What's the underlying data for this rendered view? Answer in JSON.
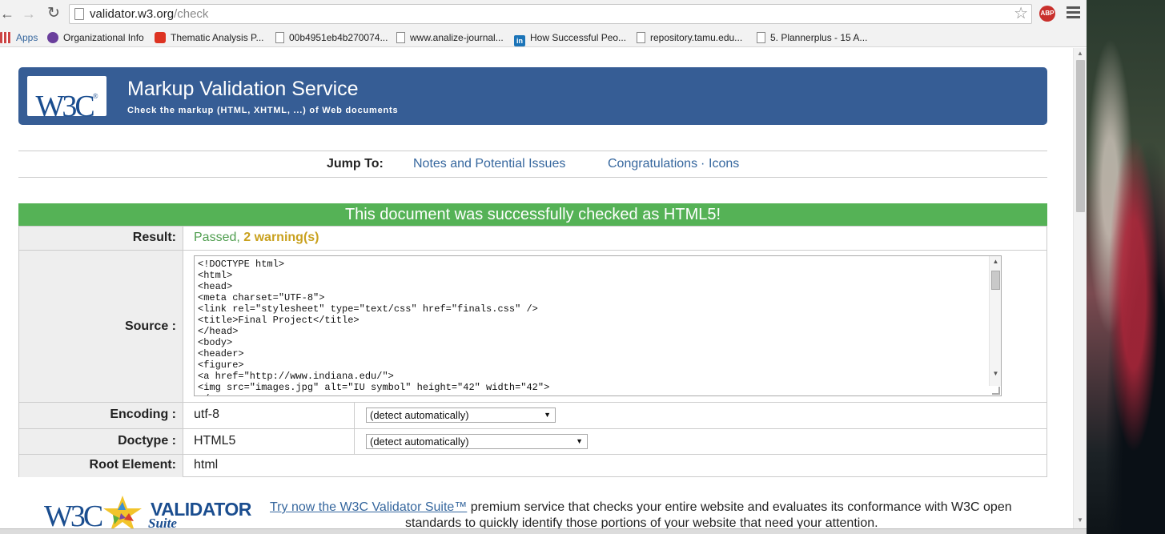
{
  "browser": {
    "url_host": "validator.w3.org",
    "url_path": "/check",
    "abp_label": "ABP",
    "bookmarks": [
      {
        "label": "Apps",
        "icon": "apps-grid-icon"
      },
      {
        "label": "Organizational Info",
        "icon": "org-icon"
      },
      {
        "label": "Thematic Analysis P...",
        "icon": "youtube-icon"
      },
      {
        "label": "00b4951eb4b270074...",
        "icon": "page-icon"
      },
      {
        "label": "www.analize-journal...",
        "icon": "page-icon"
      },
      {
        "label": "How Successful Peo...",
        "icon": "linkedin-icon"
      },
      {
        "label": "repository.tamu.edu...",
        "icon": "page-icon"
      },
      {
        "label": "5. Plannerplus - 15 A...",
        "icon": "page-icon"
      }
    ]
  },
  "banner": {
    "logo_text": "W3C",
    "logo_reg": "®",
    "title": "Markup Validation Service",
    "subtitle": "Check the markup (HTML, XHTML, ...) of Web documents"
  },
  "jump": {
    "label": "Jump To:",
    "notes": "Notes and Potential Issues",
    "congrats": "Congratulations",
    "separator": "·",
    "icons": "Icons"
  },
  "result": {
    "heading": "This document was successfully checked as HTML5!",
    "result_label": "Result:",
    "passed_text": "Passed,",
    "warnings_text": "2 warning(s)",
    "source_label": "Source :",
    "source_code": "<!DOCTYPE html>\n<html>\n<head>\n<meta charset=\"UTF-8\">\n<link rel=\"stylesheet\" type=\"text/css\" href=\"finals.css\" />\n<title>Final Project</title>\n</head>\n<body>\n<header>\n<figure>\n<a href=\"http://www.indiana.edu/\">\n<img src=\"images.jpg\" alt=\"IU symbol\" height=\"42\" width=\"42\">\n</a>",
    "encoding_label": "Encoding :",
    "encoding_value": "utf-8",
    "encoding_option": "(detect automatically)",
    "doctype_label": "Doctype :",
    "doctype_value": "HTML5",
    "doctype_option": "(detect automatically)",
    "root_label": "Root Element:",
    "root_value": "html"
  },
  "promo": {
    "logo_w3c": "W3C",
    "logo_validator": "VALIDATOR",
    "logo_suite": "Suite",
    "link_text": "Try now the W3C Validator Suite™",
    "line1_rest": " premium service that checks your entire website and evaluates its conformance with W3C open",
    "line2": "standards to quickly identify those portions of your website that need your attention."
  },
  "colors": {
    "banner": "#365d95",
    "success": "#55b256",
    "link": "#36679e",
    "warning": "#c9a11e"
  }
}
